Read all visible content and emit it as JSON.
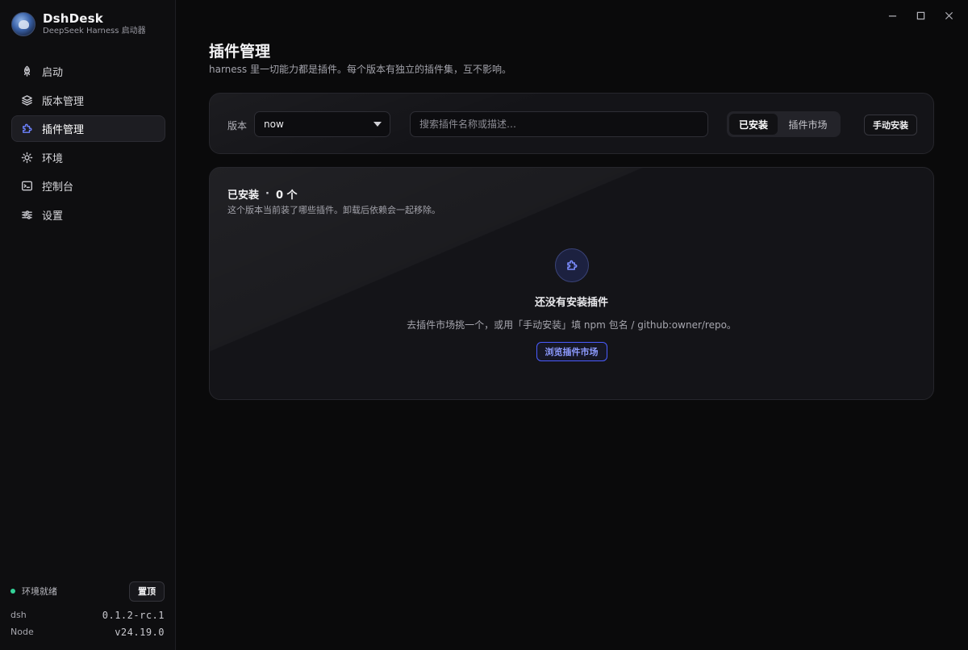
{
  "brand": {
    "name": "DshDesk",
    "subtitle": "DeepSeek Harness 启动器"
  },
  "nav": {
    "items": [
      {
        "label": "启动",
        "icon": "rocket-icon"
      },
      {
        "label": "版本管理",
        "icon": "layers-icon"
      },
      {
        "label": "插件管理",
        "icon": "puzzle-icon",
        "active": true
      },
      {
        "label": "环境",
        "icon": "sun-icon"
      },
      {
        "label": "控制台",
        "icon": "terminal-icon"
      },
      {
        "label": "设置",
        "icon": "sliders-icon"
      }
    ]
  },
  "footer": {
    "env_status": "环境就绪",
    "pin_label": "置顶",
    "versions": [
      {
        "label": "dsh",
        "value": "0.1.2-rc.1"
      },
      {
        "label": "Node",
        "value": "v24.19.0"
      }
    ]
  },
  "window_controls": [
    "minimize-icon",
    "maximize-icon",
    "close-icon"
  ],
  "page": {
    "title": "插件管理",
    "description": "harness 里一切能力都是插件。每个版本有独立的插件集，互不影响。"
  },
  "toolbar": {
    "version_label": "版本",
    "version_value": "now",
    "search_placeholder": "搜索插件名称或描述…",
    "tabs": [
      {
        "label": "已安装",
        "active": true
      },
      {
        "label": "插件市场",
        "active": false
      }
    ],
    "manual_install_label": "手动安装"
  },
  "installed": {
    "heading": "已安装",
    "separator": "·",
    "count": "0 个",
    "subtitle": "这个版本当前装了哪些插件。卸载后依赖会一起移除。",
    "empty_title": "还没有安装插件",
    "empty_desc": "去插件市场挑一个，或用「手动安装」填 npm 包名 / github:owner/repo。",
    "browse_label": "浏览插件市场"
  },
  "colors": {
    "accent": "#6d82ff",
    "status_ok": "#34d399",
    "background": "#0a0a0b"
  }
}
